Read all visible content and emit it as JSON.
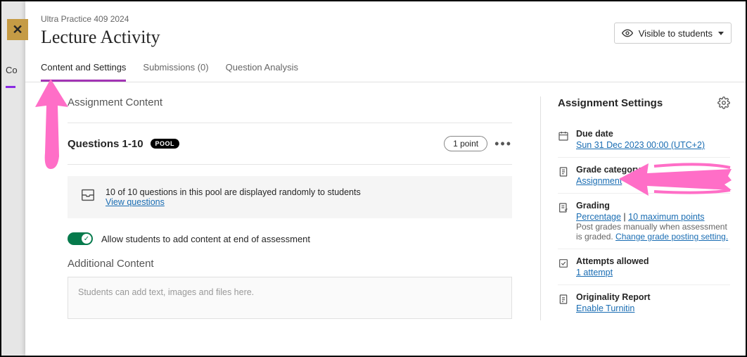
{
  "breadcrumb": "Ultra Practice 409 2024",
  "page_title": "Lecture Activity",
  "visibility_label": "Visible to students",
  "tabs": {
    "content": "Content and Settings",
    "submissions": "Submissions (0)",
    "analysis": "Question Analysis"
  },
  "behind_tab": "Co",
  "main": {
    "section_head": "Assignment Content",
    "questions": {
      "title": "Questions 1-10",
      "pool_badge": "POOL",
      "points": "1 point",
      "info_line": "10 of 10 questions in this pool are displayed randomly to students",
      "view_link": "View questions"
    },
    "toggle_label": "Allow students to add content at end of assessment",
    "additional_head": "Additional Content",
    "additional_placeholder": "Students can add text, images and files here."
  },
  "settings": {
    "header": "Assignment Settings",
    "due_date": {
      "label": "Due date",
      "value": "Sun 31 Dec 2023 00:00 (UTC+2)"
    },
    "grade_category": {
      "label": "Grade category",
      "value": "Assignment"
    },
    "grading": {
      "label": "Grading",
      "link1": "Percentage",
      "sep": " | ",
      "link2": "10 maximum points",
      "desc": "Post grades manually when assessment is graded. ",
      "link3": "Change grade posting setting."
    },
    "attempts": {
      "label": "Attempts allowed",
      "value": "1 attempt"
    },
    "originality": {
      "label": "Originality Report",
      "value": "Enable Turnitin"
    }
  }
}
